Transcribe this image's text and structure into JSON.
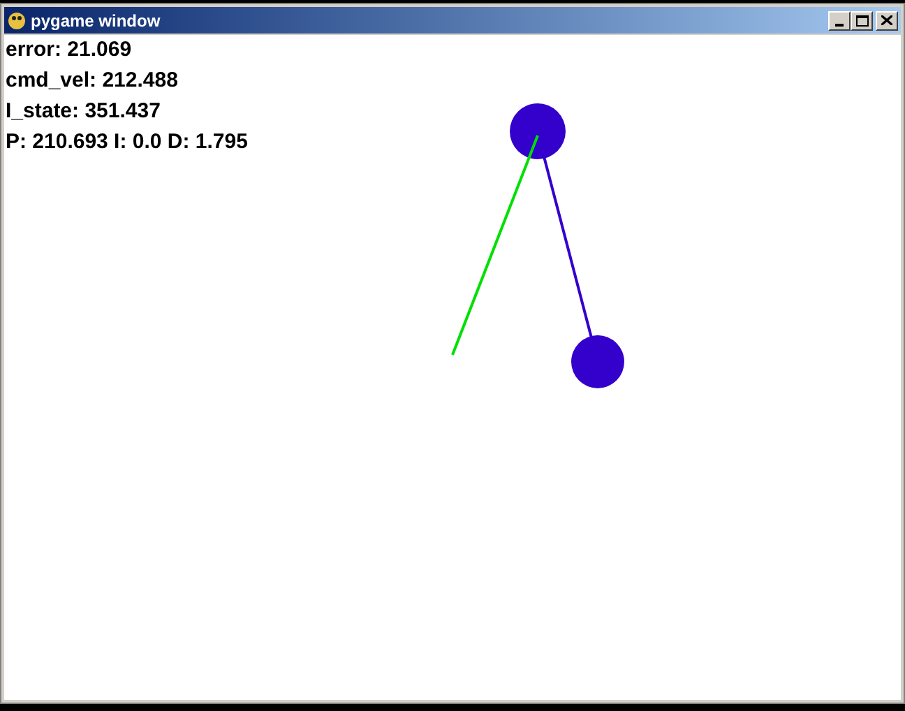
{
  "window": {
    "title": "pygame window"
  },
  "readouts": [
    "error: 21.069",
    "cmd_vel: 212.488",
    "I_state: 351.437",
    "P: 210.693 I: 0.0 D: 1.795"
  ]
}
